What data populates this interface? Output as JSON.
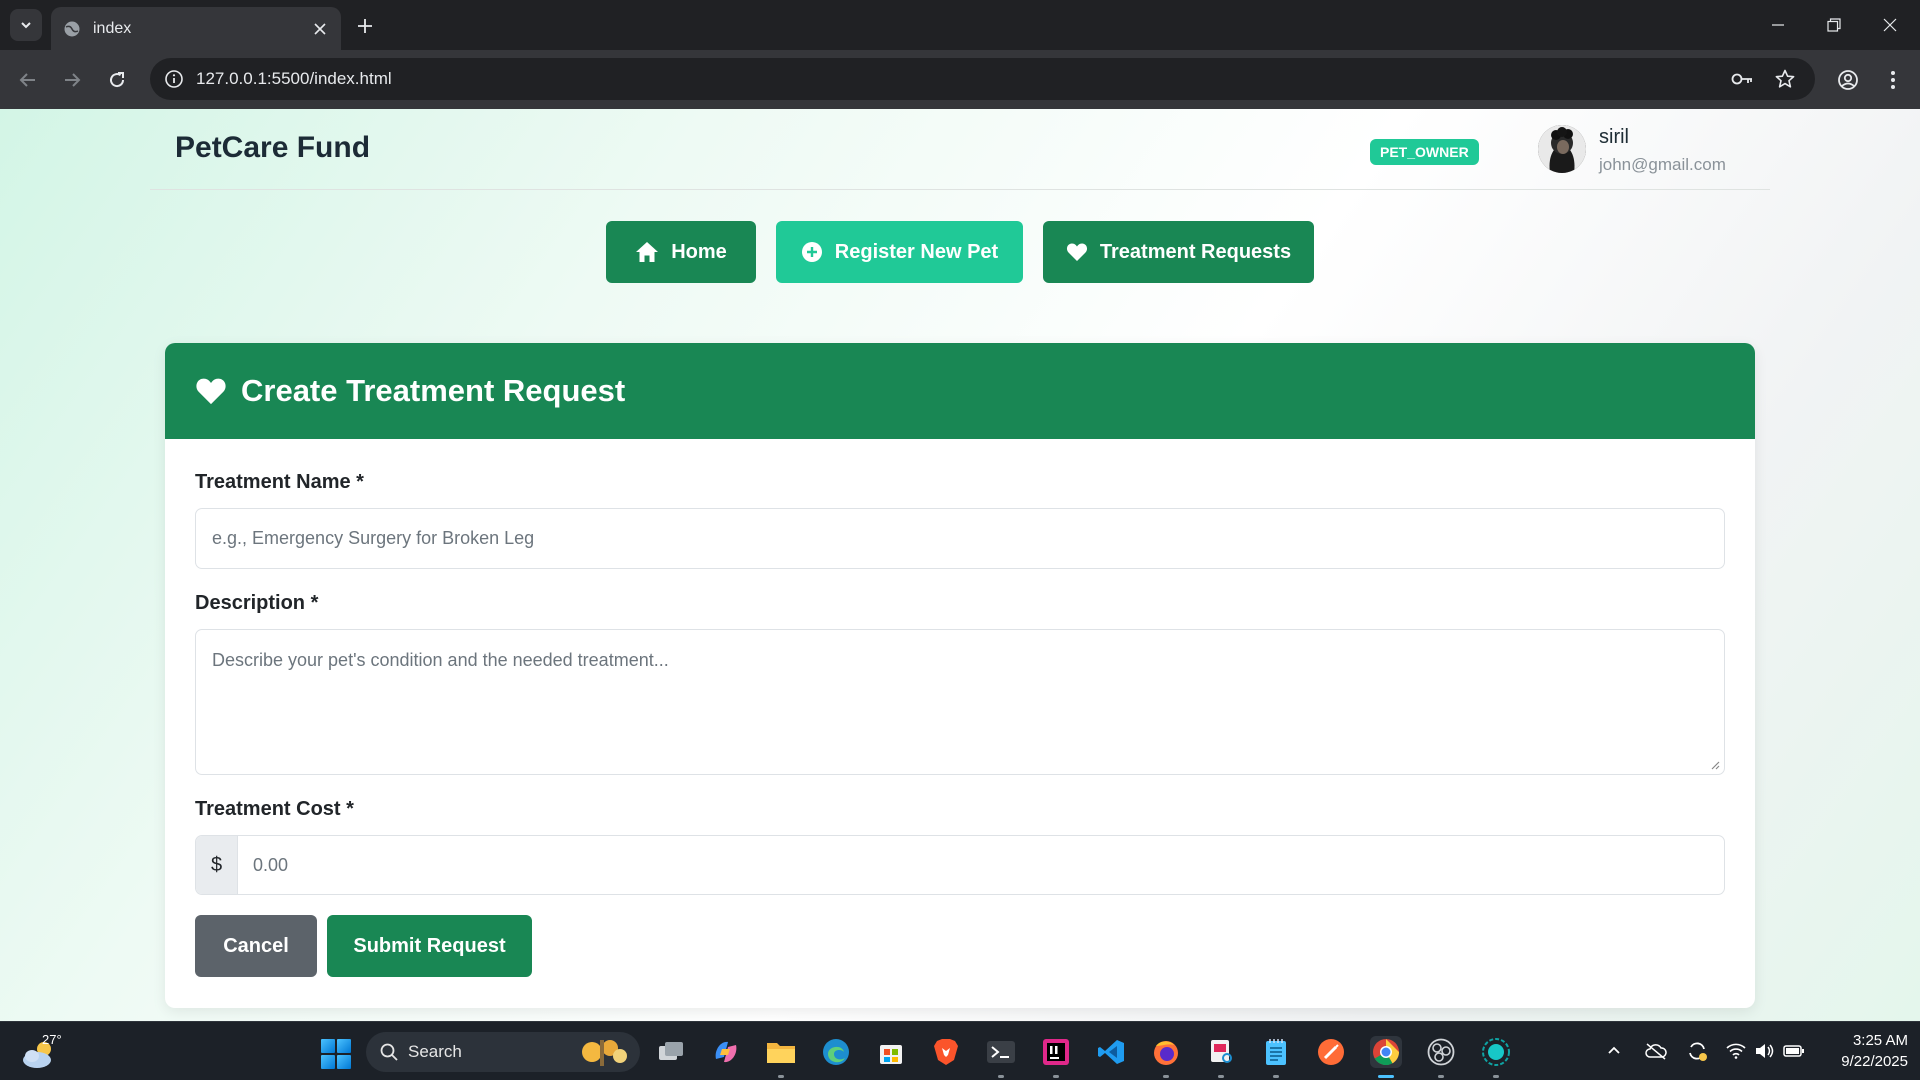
{
  "browser": {
    "tab_title": "index",
    "url": "127.0.0.1:5500/index.html"
  },
  "app": {
    "brand": "PetCare Fund",
    "role_badge": "PET_OWNER",
    "user": {
      "name": "siril",
      "email": "john@gmail.com"
    },
    "nav": {
      "home": "Home",
      "register": "Register New Pet",
      "treatments": "Treatment Requests"
    }
  },
  "form": {
    "title": "Create Treatment Request",
    "treatment_name_label": "Treatment Name *",
    "treatment_name_placeholder": "e.g., Emergency Surgery for Broken Leg",
    "description_label": "Description *",
    "description_placeholder": "Describe your pet's condition and the needed treatment...",
    "cost_label": "Treatment Cost *",
    "currency_symbol": "$",
    "cost_placeholder": "0.00",
    "cancel_label": "Cancel",
    "submit_label": "Submit Request"
  },
  "taskbar": {
    "weather_temp": "27°",
    "search_label": "Search",
    "time": "3:25 AM",
    "date": "9/22/2025"
  },
  "colors": {
    "primary_green": "#198754",
    "teal": "#20c997",
    "secondary_gray": "#5c636a"
  }
}
